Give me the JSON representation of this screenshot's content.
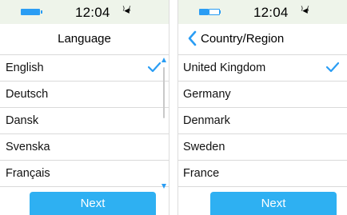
{
  "screens": [
    {
      "status": {
        "time": "12:04",
        "vibrate_icon": "vibrate-icon"
      },
      "header": {
        "title": "Language"
      },
      "list": [
        {
          "label": "English",
          "selected": true
        },
        {
          "label": "Deutsch",
          "selected": false
        },
        {
          "label": "Dansk",
          "selected": false
        },
        {
          "label": "Svenska",
          "selected": false
        },
        {
          "label": "Français",
          "selected": false
        }
      ],
      "next_label": "Next"
    },
    {
      "status": {
        "time": "12:04",
        "vibrate_icon": "vibrate-icon"
      },
      "header": {
        "title": "Country/Region",
        "back_icon": "chevron-left-icon"
      },
      "list": [
        {
          "label": "United Kingdom",
          "selected": true
        },
        {
          "label": "Germany",
          "selected": false
        },
        {
          "label": "Denmark",
          "selected": false
        },
        {
          "label": "Sweden",
          "selected": false
        },
        {
          "label": "France",
          "selected": false
        }
      ],
      "next_label": "Next"
    }
  ],
  "colors": {
    "accent": "#2a9df4",
    "button": "#2eb0f2",
    "statusbar": "#eef4ea"
  }
}
